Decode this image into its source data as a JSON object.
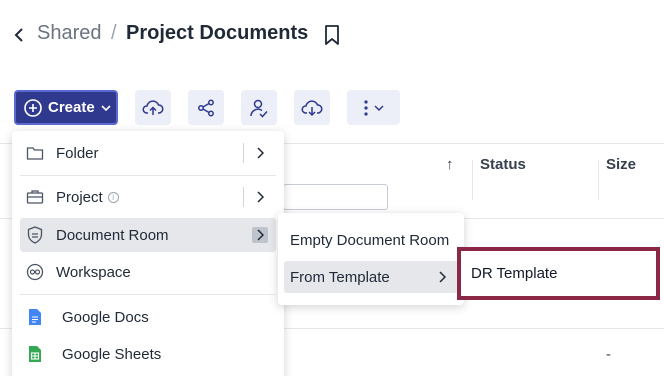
{
  "breadcrumb": {
    "parent": "Shared",
    "separator": "/",
    "current": "Project Documents"
  },
  "toolbar": {
    "create_label": "Create"
  },
  "table": {
    "columns": {
      "status": "Status",
      "size": "Size"
    },
    "row_size_value": "-"
  },
  "create_menu": {
    "items": [
      {
        "label": "Folder",
        "icon": "folder-icon"
      },
      {
        "label": "Project",
        "icon": "briefcase-icon"
      },
      {
        "label": "Document Room",
        "icon": "shield-icon"
      },
      {
        "label": "Workspace",
        "icon": "workspace-icon"
      },
      {
        "label": "Google Docs",
        "icon": "google-docs-icon",
        "color": "#4285f4"
      },
      {
        "label": "Google Sheets",
        "icon": "google-sheets-icon",
        "color": "#34a853"
      }
    ]
  },
  "document_room_submenu": {
    "items": [
      {
        "label": "Empty Document Room"
      },
      {
        "label": "From Template"
      }
    ]
  },
  "template_submenu": {
    "items": [
      {
        "label": "DR Template"
      }
    ]
  },
  "colors": {
    "create_button": "#2f3a8f",
    "highlight_border": "#8a2846",
    "tool_bg": "#eceef8"
  }
}
